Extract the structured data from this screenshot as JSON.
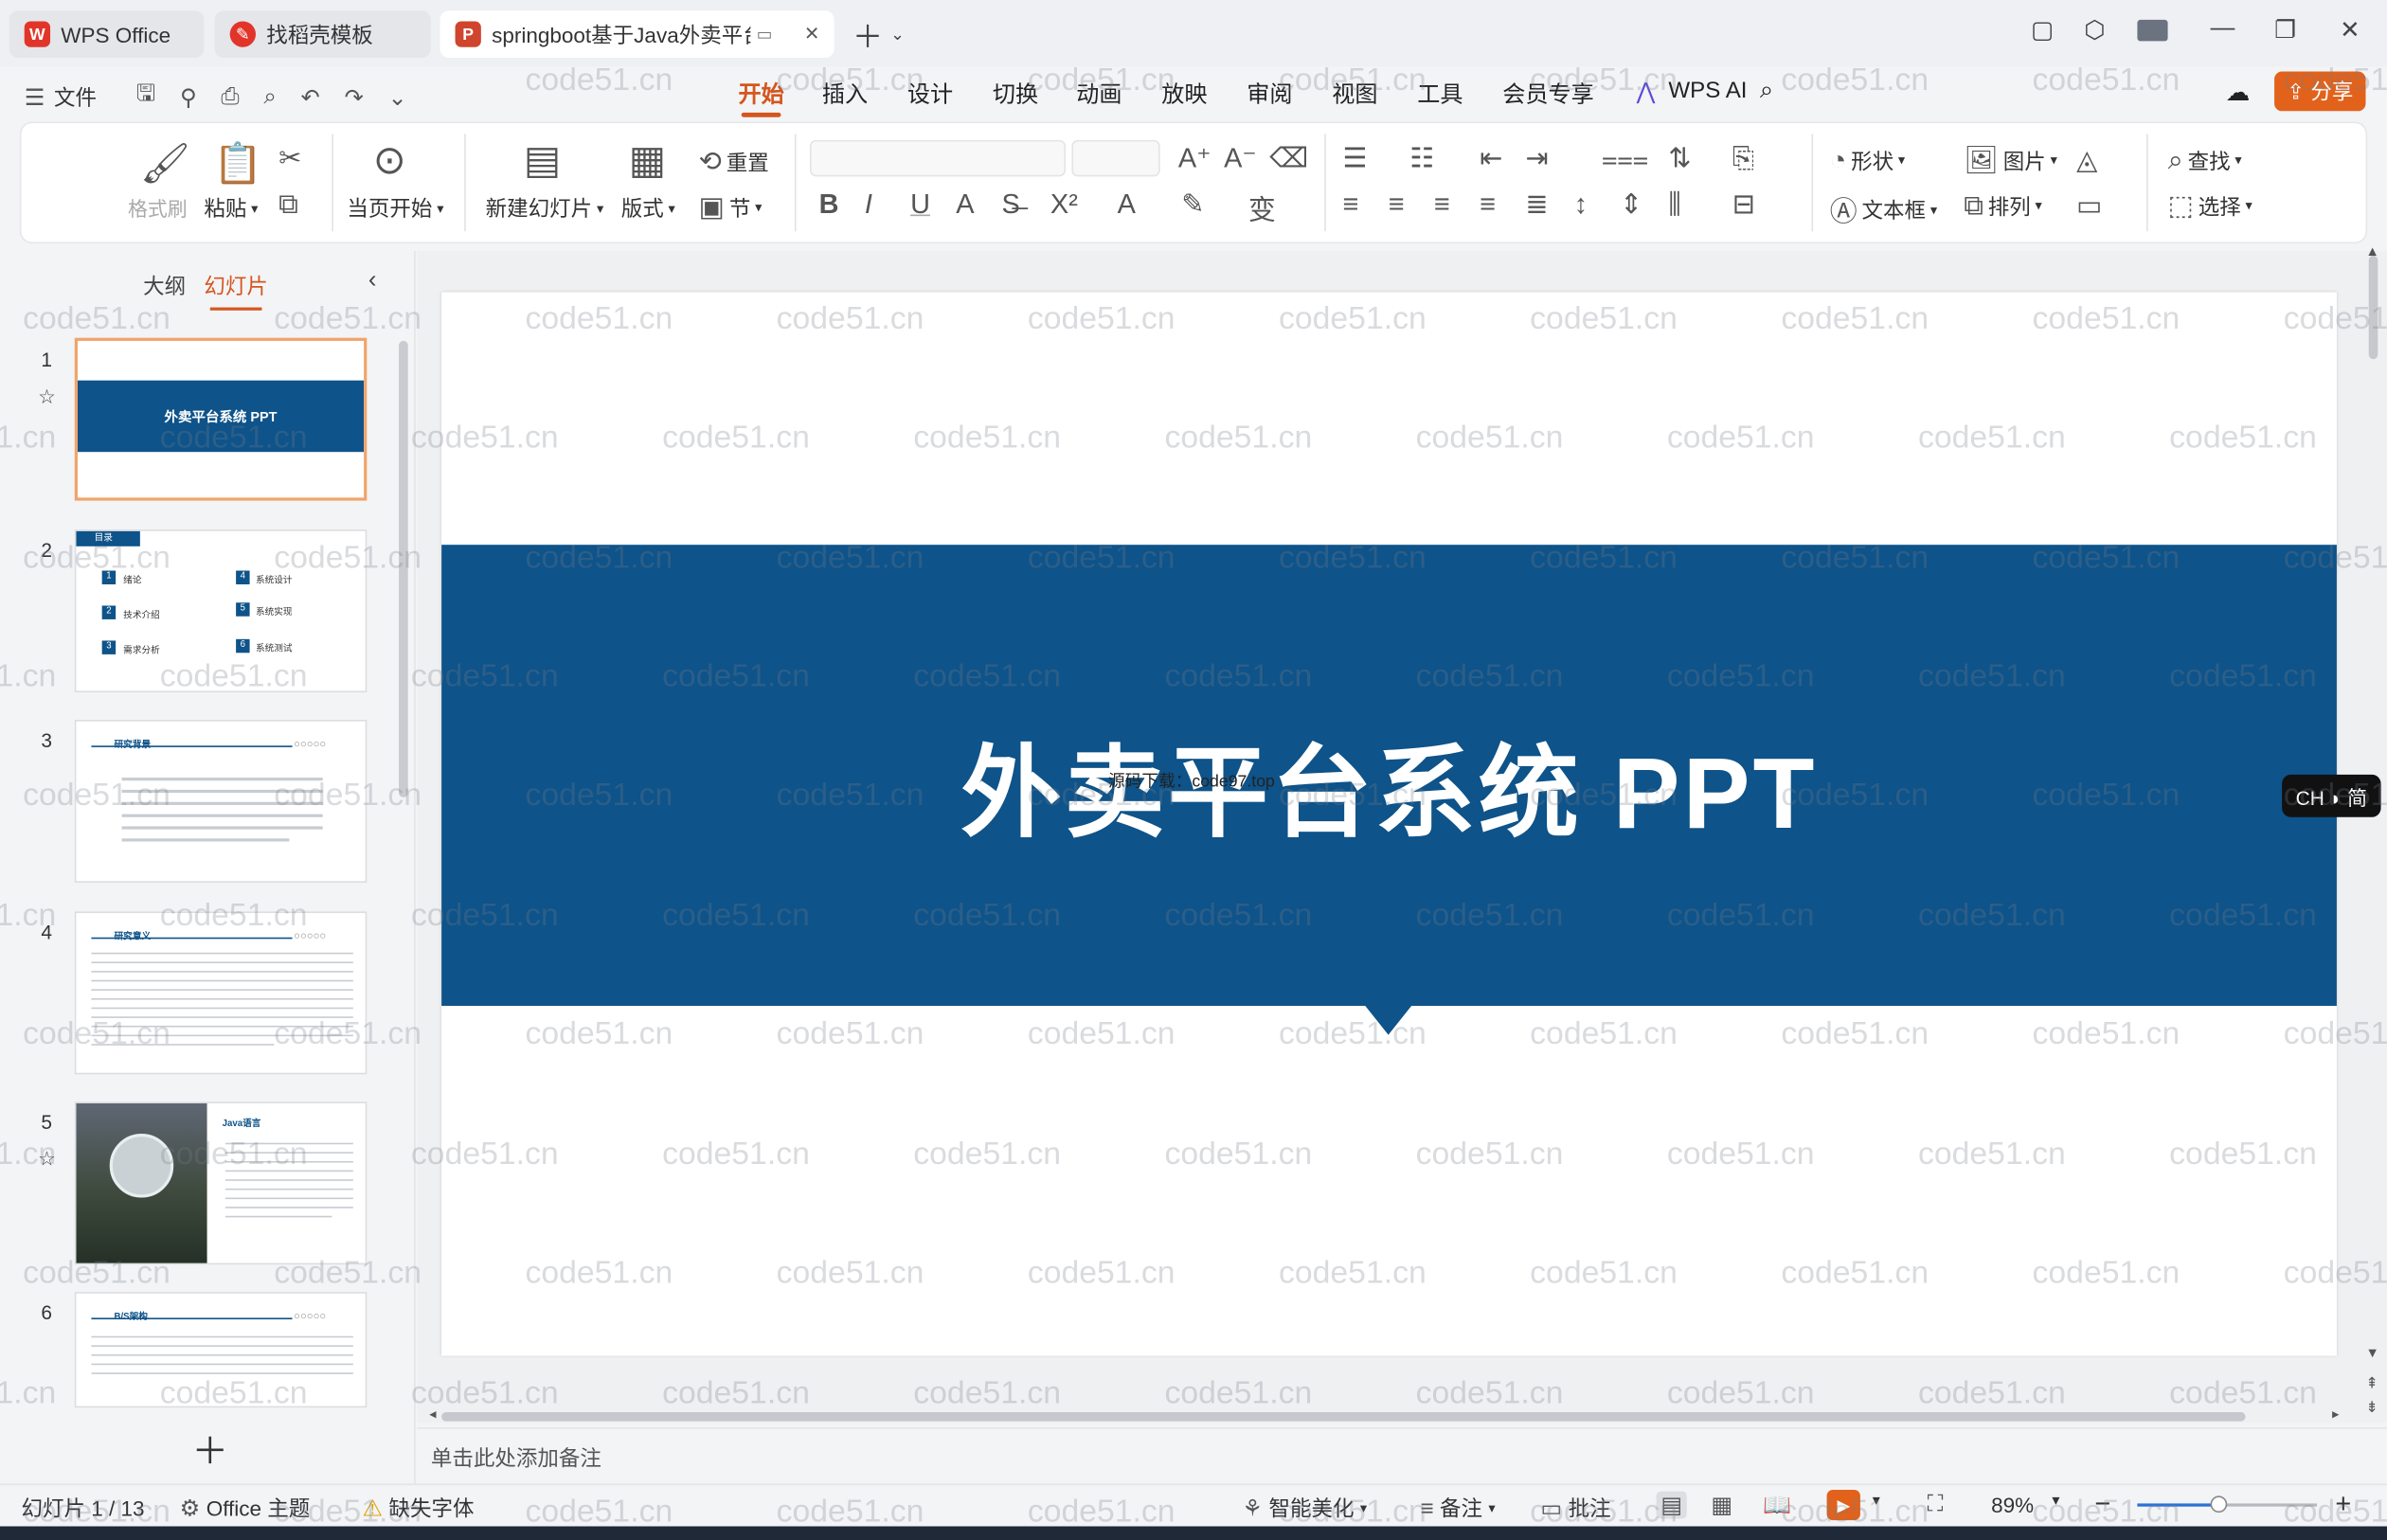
{
  "tabs": [
    {
      "label": "WPS Office",
      "icon": "wps-logo-icon"
    },
    {
      "label": "找稻壳模板",
      "icon": "docer-icon"
    },
    {
      "label": "springboot基于Java外卖平台系统",
      "icon": "ppt-file-icon"
    }
  ],
  "menu": {
    "file_label": "文件",
    "tabs": [
      "开始",
      "插入",
      "设计",
      "切换",
      "动画",
      "放映",
      "审阅",
      "视图",
      "工具",
      "会员专享",
      "WPS AI"
    ],
    "active_tab": "开始",
    "share_label": "分享"
  },
  "ribbon": {
    "format_painter": "格式刷",
    "paste": "粘贴",
    "from_current": "当页开始",
    "new_slide": "新建幻灯片",
    "layout": "版式",
    "reset": "重置",
    "section": "节",
    "shape": "形状",
    "picture": "图片",
    "find": "查找",
    "textbox": "文本框",
    "arrange": "排列",
    "select": "选择"
  },
  "left_panel": {
    "tab_outline": "大纲",
    "tab_slides": "幻灯片",
    "active_tab": "幻灯片",
    "slides": [
      {
        "number": "1",
        "title": "外卖平台系统 PPT"
      },
      {
        "number": "2",
        "title": "目录",
        "items": [
          "绪论",
          "技术介绍",
          "需求分析",
          "系统设计",
          "系统实现",
          "系统测试"
        ]
      },
      {
        "number": "3",
        "title": "研究背景"
      },
      {
        "number": "4",
        "title": "研究意义"
      },
      {
        "number": "5",
        "title": "Java语言"
      },
      {
        "number": "6",
        "title": "B/S架构"
      }
    ]
  },
  "slide": {
    "title": "外卖平台系统  PPT",
    "overlay_text": "源码下载：code97.top",
    "band_color": "#0e5389"
  },
  "notes_placeholder": "单击此处添加备注",
  "status": {
    "slide_counter": "幻灯片 1 / 13",
    "theme": "Office 主题",
    "missing_font": "缺失字体",
    "beautify": "智能美化",
    "notes": "备注",
    "comments": "批注",
    "zoom": "89%",
    "zoom_fraction": 0.45
  },
  "ime_indicator": "CH ◗ 简",
  "watermark": "code51.cn",
  "colors": {
    "accent": "#d4561f",
    "share": "#e2621b",
    "slide_band": "#0e5389"
  }
}
